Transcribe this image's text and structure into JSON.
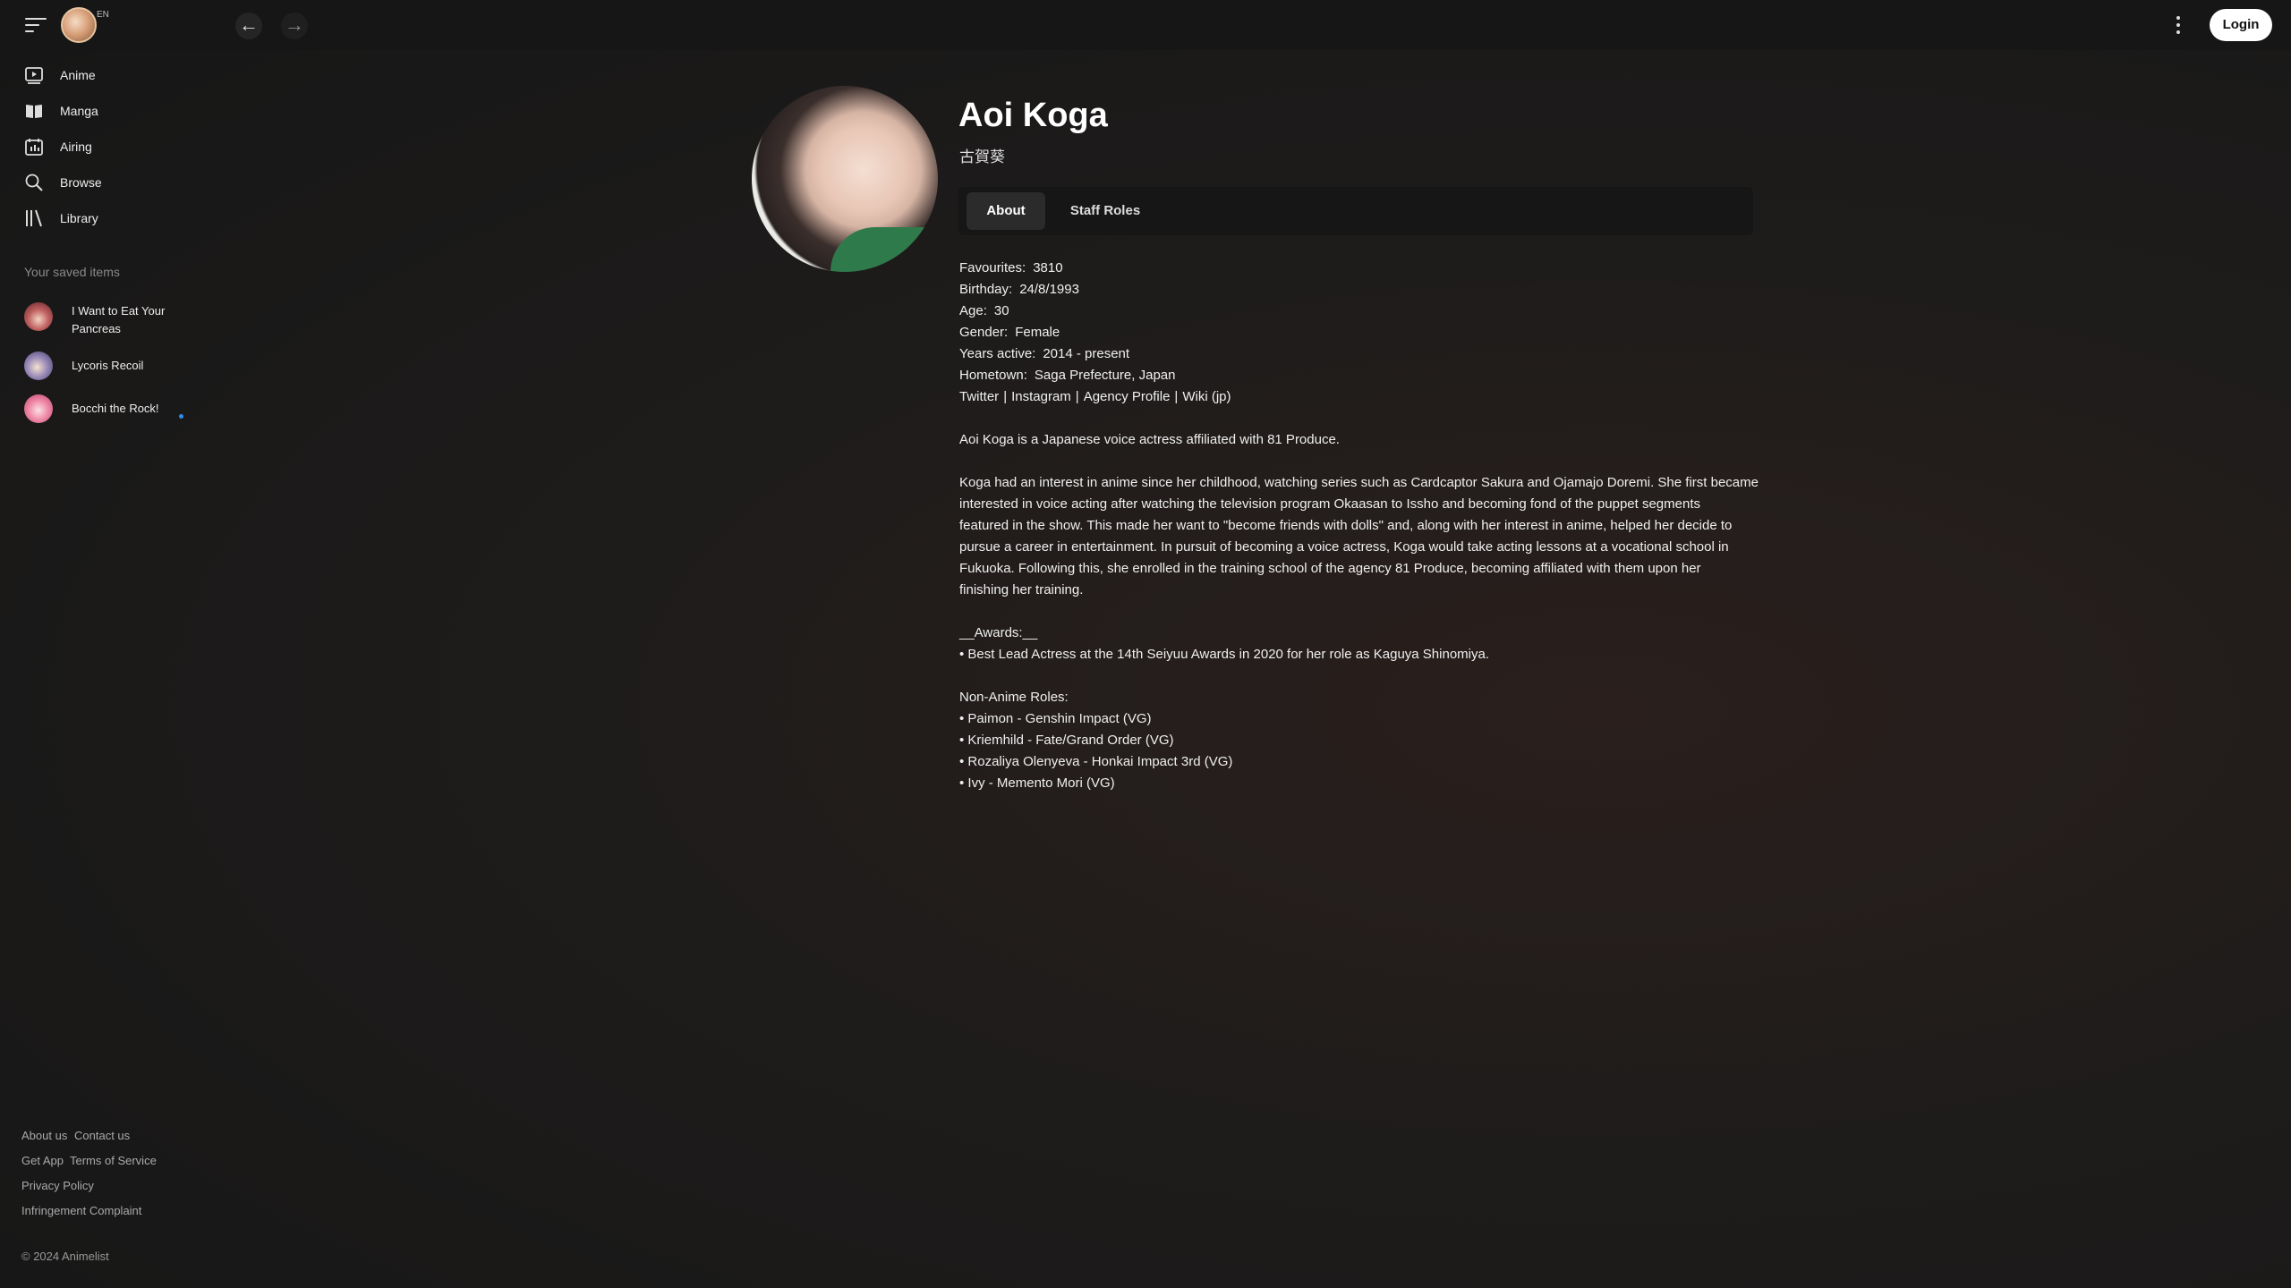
{
  "header": {
    "lang": "EN",
    "login_label": "Login",
    "back_arrow": "←",
    "forward_arrow": "→"
  },
  "sidebar": {
    "items": [
      {
        "label": "Anime",
        "icon": "play-box-icon"
      },
      {
        "label": "Manga",
        "icon": "book-icon"
      },
      {
        "label": "Airing",
        "icon": "calendar-icon"
      },
      {
        "label": "Browse",
        "icon": "search-icon"
      },
      {
        "label": "Library",
        "icon": "library-icon"
      }
    ],
    "saved_title": "Your saved items",
    "saved": [
      {
        "line1": "I Want to Eat Your",
        "line2": "Pancreas"
      },
      {
        "line1": "Lycoris Recoil",
        "line2": ""
      },
      {
        "line1": "Bocchi the Rock!",
        "line2": ""
      }
    ]
  },
  "footer": {
    "about": "About us",
    "contact": "Contact us",
    "get_app": "Get App",
    "terms": "Terms of Service",
    "privacy": "Privacy Policy",
    "infringement": "Infringement Complaint",
    "copyright": "© 2024 Animelist"
  },
  "profile": {
    "name": "Aoi Koga",
    "native_name": "古賀葵",
    "tabs": {
      "about": "About",
      "staff_roles": "Staff Roles"
    },
    "info": [
      {
        "key": "Favourites:",
        "value": "3810"
      },
      {
        "key": "Birthday:",
        "value": "24/8/1993"
      },
      {
        "key": "Age:",
        "value": "30"
      },
      {
        "key": "Gender:",
        "value": "Female"
      },
      {
        "key": "Years active:",
        "value": "2014 - present"
      },
      {
        "key": "Hometown:",
        "value": "Saga Prefecture, Japan"
      }
    ],
    "links": {
      "twitter": "Twitter",
      "instagram": "Instagram",
      "agency": "Agency Profile",
      "wiki": "Wiki (jp)",
      "sep": "|"
    },
    "intro": "Aoi Koga is a Japanese voice actress affiliated with 81 Produce.",
    "bio": [
      "Koga had an interest in anime since her childhood, watching series such as Cardcaptor Sakura and Ojamajo Doremi. She first became",
      "interested in voice acting after watching the television program Okaasan to Issho and becoming fond of the puppet segments",
      "featured in the show. This made her want to \"become friends with dolls\" and, along with her interest in anime, helped her decide to",
      "pursue a career in entertainment. In pursuit of becoming a voice actress, Koga would take acting lessons at a vocational school in",
      "Fukuoka. Following this, she enrolled in the training school of the agency 81 Produce, becoming affiliated with them upon her",
      "finishing her training."
    ],
    "awards_title": "__Awards:__",
    "awards": [
      "• Best Lead Actress at the 14th Seiyuu Awards in 2020 for her role as Kaguya Shinomiya."
    ],
    "non_anime_title": "Non-Anime Roles:",
    "non_anime": [
      "• Paimon - Genshin Impact (VG)",
      "• Kriemhild - Fate/Grand Order (VG)",
      "• Rozaliya Olenyeva - Honkai Impact 3rd (VG)",
      "• Ivy - Memento Mori (VG)"
    ]
  }
}
